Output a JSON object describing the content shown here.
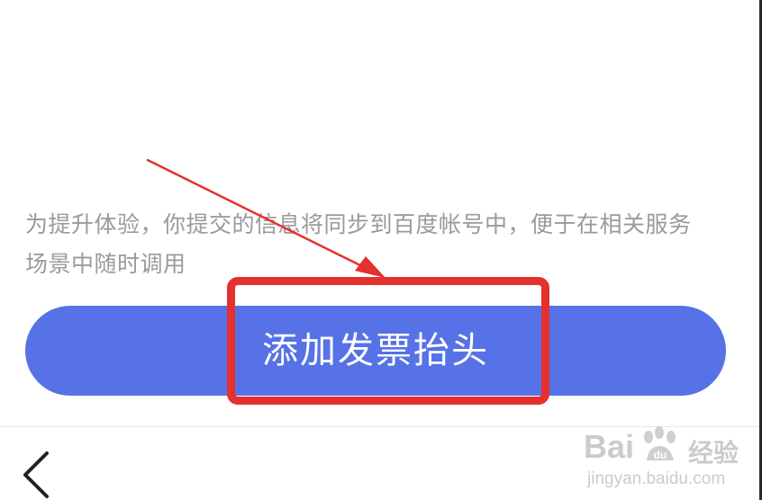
{
  "notice": {
    "line1": "为提升体验，你提交的信息将同步到百度帐号中，便于在相关服务",
    "line2": "场景中随时调用"
  },
  "add_button": {
    "label": "添加发票抬头"
  },
  "navigation": {
    "back_icon": "chevron-left-icon"
  },
  "watermark": {
    "brand_left": "Bai",
    "brand_mark": "du",
    "brand_cn": "经验",
    "url": "jingyan.baidu.com"
  },
  "colors": {
    "button_bg": "#5672e6",
    "highlight": "#e4312e",
    "notice_text": "#9a9a9a"
  }
}
